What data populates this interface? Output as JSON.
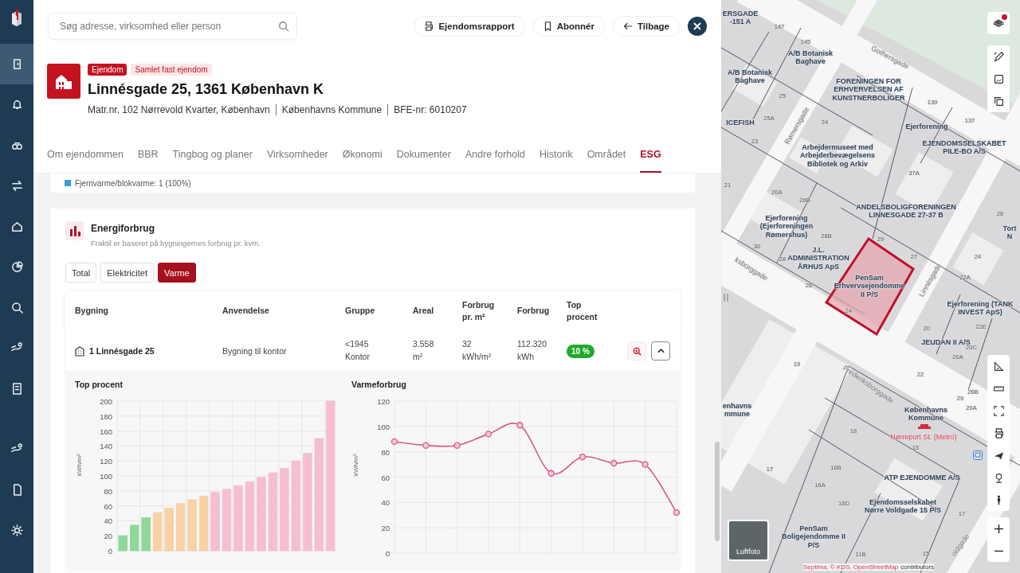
{
  "sidebar": {
    "items": [
      {
        "selected": true
      },
      {
        "selected": false
      },
      {
        "selected": false
      },
      {
        "selected": false
      },
      {
        "selected": false
      },
      {
        "selected": false
      },
      {
        "selected": false
      },
      {
        "selected": false
      },
      {
        "selected": false
      },
      {
        "selected": false
      },
      {
        "selected": false
      },
      {
        "selected": false
      }
    ]
  },
  "search": {
    "placeholder": "Søg adresse, virksomhed eller person"
  },
  "actions": [
    {
      "label": "Ejendomsrapport",
      "kind": "print"
    },
    {
      "label": "Abonnér",
      "kind": "bookmark"
    },
    {
      "label": "Tilbage",
      "kind": "back"
    }
  ],
  "property": {
    "badges": [
      {
        "label": "Ejendom",
        "kind": "solid"
      },
      {
        "label": "Samlet fast ejendom",
        "kind": "soft"
      }
    ],
    "title": "Linnésgade 25, 1361 København K",
    "details": [
      "Matr.nr. 102 Nørrevold Kvarter, København",
      "Københavns Kommune",
      "BFE-nr: 6010207"
    ]
  },
  "tabs": [
    {
      "label": "Om ejendommen",
      "selected": false
    },
    {
      "label": "BBR",
      "selected": false
    },
    {
      "label": "Tingbog og planer",
      "selected": false
    },
    {
      "label": "Virksomheder",
      "selected": false
    },
    {
      "label": "Økonomi",
      "selected": false
    },
    {
      "label": "Dokumenter",
      "selected": false
    },
    {
      "label": "Andre forhold",
      "selected": false
    },
    {
      "label": "Historik",
      "selected": false
    },
    {
      "label": "Området",
      "selected": false
    },
    {
      "label": "ESG",
      "selected": true
    }
  ],
  "heating_line": "Fjernvarme/blokvarme: 1 (100%)",
  "energy": {
    "title": "Energiforbrug",
    "subtitle": "Fraktil er baseret på bygningernes forbrug pr. kvm.",
    "segments": [
      {
        "label": "Total",
        "selected": false
      },
      {
        "label": "Elektricitet",
        "selected": false
      },
      {
        "label": "Varme",
        "selected": true
      }
    ],
    "columns": [
      "Bygning",
      "Anvendelse",
      "Gruppe",
      "Areal",
      "Forbrug pr. m²",
      "Forbrug",
      "Top procent"
    ],
    "rows": [
      {
        "building": "1 Linnésgade 25",
        "usage": "Bygning til kontor",
        "group": "<1945\nKontor",
        "area": "3.558\nm²",
        "per_m2": "32\nkWh/m²",
        "consumption": "112.320\nkWh",
        "top_percent": "10 %",
        "expanded": true
      }
    ],
    "charts": [
      {
        "chart_data": {
          "type": "bar",
          "title": "Top procent",
          "ylabel": "kWh/m²",
          "ylim": [
            0,
            200
          ],
          "yticks": [
            0,
            20,
            40,
            60,
            80,
            100,
            120,
            140,
            160,
            180,
            200
          ],
          "grid": true,
          "series": [
            {
              "color": "#8fd79a",
              "values": [
                20,
                34,
                44,
                null,
                null,
                null,
                null,
                null,
                null,
                null,
                null,
                null,
                null,
                null,
                null,
                null,
                null,
                null,
                null
              ]
            },
            {
              "color": "#f6d2a6",
              "values": [
                null,
                null,
                null,
                51,
                57,
                63,
                68,
                73,
                null,
                null,
                null,
                null,
                null,
                null,
                null,
                null,
                null,
                null,
                null
              ]
            },
            {
              "color": "#f5bfd0",
              "values": [
                null,
                null,
                null,
                null,
                null,
                null,
                null,
                null,
                78,
                82,
                87,
                92,
                98,
                104,
                110,
                120,
                130,
                150,
                200
              ]
            }
          ]
        }
      },
      {
        "chart_data": {
          "type": "line",
          "title": "Varmeforbrug",
          "ylabel": "kWh/m²",
          "ylim": [
            0,
            120
          ],
          "yticks": [
            0,
            20,
            40,
            60,
            80,
            100,
            120
          ],
          "grid": true,
          "series": [
            {
              "color": "#d9577e",
              "marker": true,
              "values": [
                88,
                85,
                85,
                94,
                101,
                63,
                76,
                71,
                70,
                32
              ]
            }
          ]
        }
      }
    ]
  },
  "map": {
    "labels": [
      {
        "text": "ERSGADE -151 A",
        "kind": "owner"
      },
      {
        "text": "147",
        "kind": "number"
      },
      {
        "text": "145",
        "kind": "number"
      },
      {
        "text": "A/B Botanisk Baghave",
        "kind": "owner"
      },
      {
        "text": "Gothersgade",
        "kind": "street"
      },
      {
        "text": "A/B Botanisk Baghave",
        "kind": "owner"
      },
      {
        "text": "25",
        "kind": "number"
      },
      {
        "text": "FORENINGEN FOR ERHVERVELSEN AF KUNSTNERBOLIGER",
        "kind": "owner"
      },
      {
        "text": "139",
        "kind": "number"
      },
      {
        "text": "ICEFISH",
        "kind": "owner"
      },
      {
        "text": "25A",
        "kind": "number"
      },
      {
        "text": "23",
        "kind": "number"
      },
      {
        "text": "Rømersgade",
        "kind": "street"
      },
      {
        "text": "24",
        "kind": "number"
      },
      {
        "text": "Ejerforening",
        "kind": "owner"
      },
      {
        "text": "137",
        "kind": "number"
      },
      {
        "text": "Arbejdermuseet med Arbejderbevægelsens Bibliotek og Arkiv",
        "kind": "owner"
      },
      {
        "text": "EJENDOMSSELSKABET PILE-BO A/S",
        "kind": "owner"
      },
      {
        "text": "37A",
        "kind": "number"
      },
      {
        "text": "21",
        "kind": "number"
      },
      {
        "text": "20A",
        "kind": "number"
      },
      {
        "text": "26B",
        "kind": "number"
      },
      {
        "text": "Ejerforening (Ejerforeningen Rømershus)",
        "kind": "owner"
      },
      {
        "text": "ANDELSBOLIGFORENINGEN LINNESGADE 27-37 B",
        "kind": "owner"
      },
      {
        "text": "26",
        "kind": "number"
      },
      {
        "text": "26B",
        "kind": "number"
      },
      {
        "text": "29",
        "kind": "number"
      },
      {
        "text": "Tort N",
        "kind": "owner"
      },
      {
        "text": "30",
        "kind": "number"
      },
      {
        "text": "ksborggade",
        "kind": "street"
      },
      {
        "text": "28",
        "kind": "number"
      },
      {
        "text": "J.L. ADMINISTRATION ÅRHUS ApS",
        "kind": "owner"
      },
      {
        "text": "27",
        "kind": "number"
      },
      {
        "text": "24",
        "kind": "number"
      },
      {
        "text": "26",
        "kind": "number"
      },
      {
        "text": "PenSam Erhvervsejendomme II P/S",
        "kind": "owner"
      },
      {
        "text": "Linnésgade",
        "kind": "street"
      },
      {
        "text": "22A",
        "kind": "number"
      },
      {
        "text": "24",
        "kind": "number"
      },
      {
        "text": "Ejerforening (TANK INVEST ApS)",
        "kind": "owner"
      },
      {
        "text": "20",
        "kind": "number"
      },
      {
        "text": "22E",
        "kind": "number"
      },
      {
        "text": "JEUDAN II A/S",
        "kind": "owner"
      },
      {
        "text": "20C",
        "kind": "number"
      },
      {
        "text": "20A",
        "kind": "number"
      },
      {
        "text": "19",
        "kind": "number"
      },
      {
        "text": "Frederiksborggade",
        "kind": "street"
      },
      {
        "text": "22",
        "kind": "number"
      },
      {
        "text": "29",
        "kind": "number"
      },
      {
        "text": "26B",
        "kind": "number"
      },
      {
        "text": "enhavns mmune",
        "kind": "owner"
      },
      {
        "text": "Københavns Kommune",
        "kind": "owner"
      },
      {
        "text": "20A",
        "kind": "number"
      },
      {
        "text": "18",
        "kind": "number"
      },
      {
        "text": "Nørreport St. (Metro)",
        "kind": "station"
      },
      {
        "text": "15",
        "kind": "number"
      },
      {
        "text": "17",
        "kind": "number"
      },
      {
        "text": "16B",
        "kind": "number"
      },
      {
        "text": "16A",
        "kind": "number"
      },
      {
        "text": "ATP EJENDOMME A/S",
        "kind": "owner"
      },
      {
        "text": "16D",
        "kind": "number"
      },
      {
        "text": "Ejendomsselskabet Nørre Voldgade 15 P/S",
        "kind": "owner"
      },
      {
        "text": "17",
        "kind": "number"
      },
      {
        "text": "PenSam Boligejendomme II P/S",
        "kind": "owner"
      },
      {
        "text": "11B",
        "kind": "number"
      },
      {
        "text": "15",
        "kind": "number"
      },
      {
        "text": "oldgade",
        "kind": "street"
      }
    ],
    "aerial_label": "Luftfoto",
    "attribution": "Septima, © KDS, OpenStreetMap",
    "attribution_suffix": "contributors"
  }
}
